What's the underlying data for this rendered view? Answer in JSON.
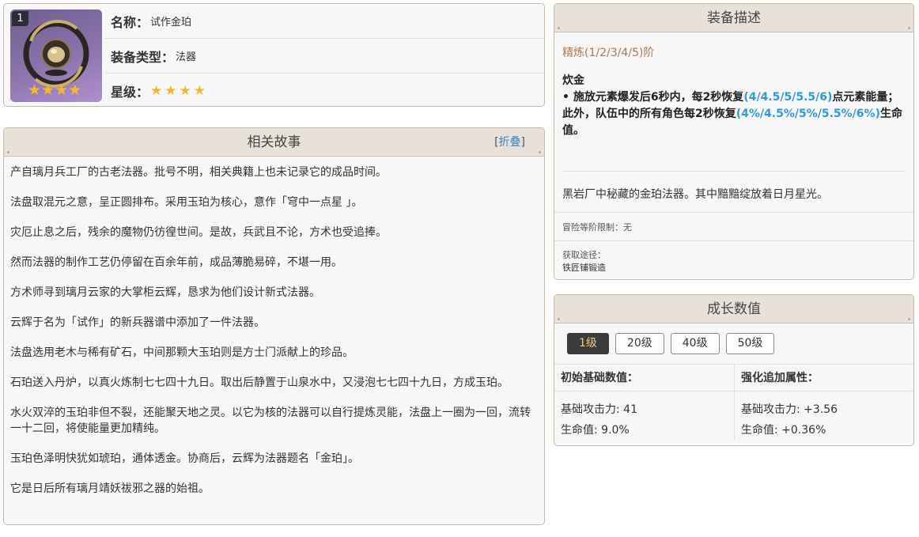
{
  "item": {
    "level_badge": "1",
    "icon_stars": "★★★★",
    "name_label": "名称：",
    "name": "试作金珀",
    "type_label": "装备类型：",
    "type": "法器",
    "rarity_label": "星级：",
    "rarity_stars": "★★★★",
    "rarity_count": 4
  },
  "story": {
    "title": "相关故事",
    "toggle_open": "[",
    "toggle_label": "折叠",
    "toggle_close": "]",
    "paragraphs": [
      "产自璃月兵工厂的古老法器。批号不明，相关典籍上也未记录它的成品时间。",
      "法盘取混元之意，呈正圆排布。采用玉珀为核心，意作「穹中一点星 」。",
      "灾厄止息之后，残余的魔物仍彷徨世间。是故，兵武且不论，方术也受追捧。",
      "然而法器的制作工艺仍停留在百余年前，成品薄脆易碎，不堪一用。",
      "方术师寻到璃月云家的大掌柜云辉，恳求为他们设计新式法器。",
      "云辉于名为「试作」的新兵器谱中添加了一件法器。",
      "法盘选用老木与稀有矿石，中间那颗大玉珀则是方士门派献上的珍品。",
      "石珀送入丹炉，以真火炼制七七四十九日。取出后静置于山泉水中，又浸泡七七四十九日，方成玉珀。",
      "水火双淬的玉珀非但不裂，还能聚天地之灵。以它为核的法器可以自行提炼灵能，法盘上一圈为一回，流转一十二回，将使能量更加精纯。",
      "玉珀色泽明快犹如琥珀，通体透金。协商后，云辉为法器题名「金珀」。",
      "它是日后所有璃月靖妖祓邪之器的始祖。"
    ]
  },
  "description": {
    "title": "装备描述",
    "refine": "精炼(1/2/3/4/5)阶",
    "passive_name": "炊金",
    "passive_a": "• 施放元素爆发后6秒内，每2秒恢复",
    "passive_b": "(4/4.5/5/5.5/6)",
    "passive_c": "点元素能量；此外，队伍中的所有角色每2秒恢复",
    "passive_d": "(4%/4.5%/5%/5.5%/6%)",
    "passive_e": "生命值。",
    "lore": "黑岩厂中秘藏的金珀法器。其中黯黯绽放着日月星光。",
    "rank_limit": "冒险等阶限制：无",
    "source_label": "获取途径：",
    "source_value": "铁匠铺锻造"
  },
  "growth": {
    "title": "成长数值",
    "tabs": [
      "1级",
      "20级",
      "40级",
      "50级"
    ],
    "active_tab": "1级",
    "base_header": "初始基础数值：",
    "bonus_header": "强化追加属性：",
    "base_atk": "基础攻击力: 41",
    "base_hp": "生命值: 9.0%",
    "bonus_atk": "基础攻击力: +3.56",
    "bonus_hp": "生命值: +0.36%"
  }
}
